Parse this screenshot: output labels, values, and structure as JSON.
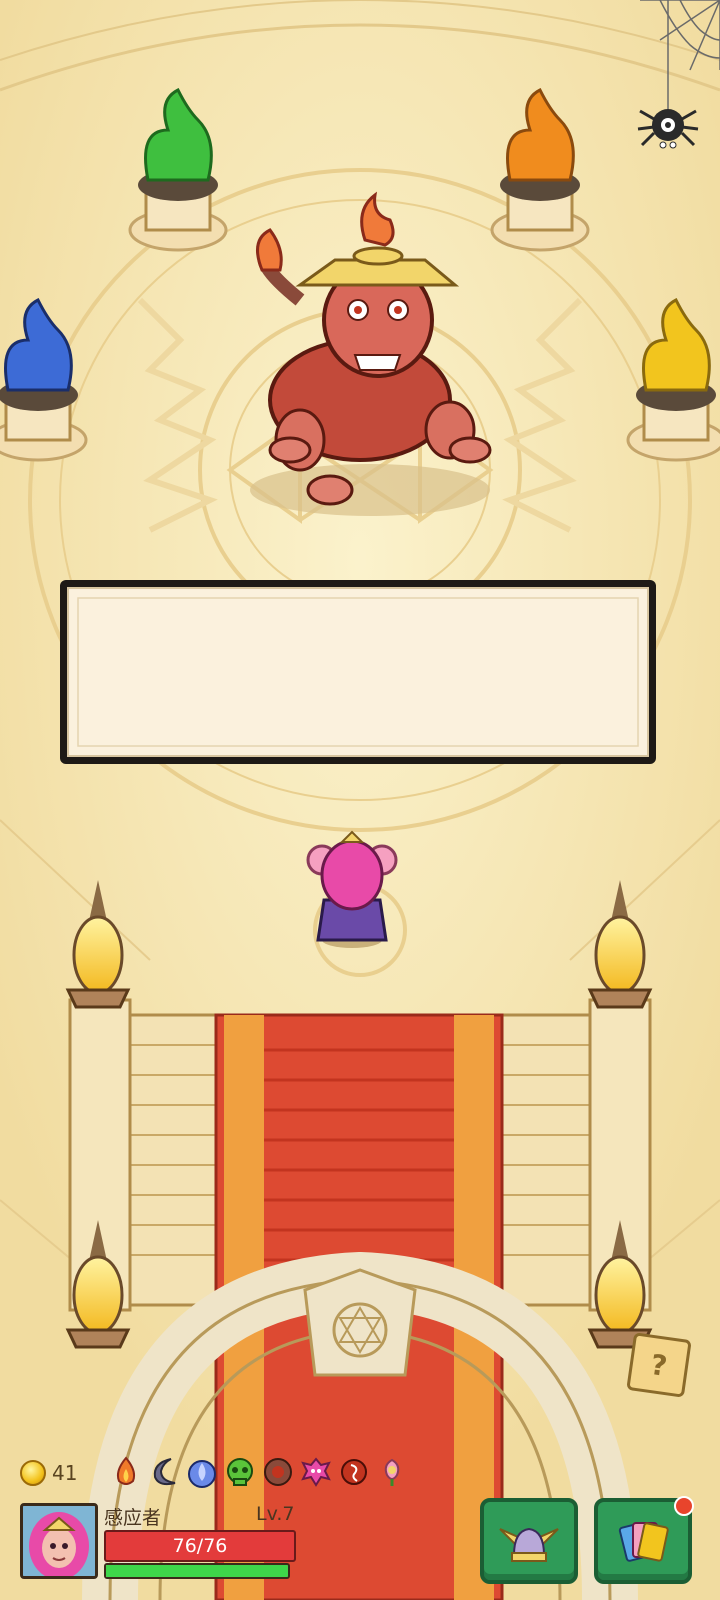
{
  "player": {
    "name": "感应者",
    "level": "Lv.7",
    "hp_text": "76/76",
    "hp_fraction": 1.0,
    "xp_fraction": 1.0
  },
  "currency": {
    "coins": "41"
  },
  "relics": [
    "fire-relic-icon",
    "crescent-relic-icon",
    "blue-flame-relic-icon",
    "skull-relic-icon",
    "shield-relic-icon",
    "pink-demon-relic-icon",
    "red-charm-relic-icon",
    "flower-relic-icon"
  ],
  "colors": {
    "hp": "#e33b3b",
    "xp": "#3ed64a",
    "button": "#2f9b58",
    "carpet": "#dd4a32",
    "flame_green": "#3fbf3f",
    "flame_orange": "#f08c1e",
    "flame_blue": "#3d6bd6",
    "flame_yellow": "#f2c51e"
  },
  "dialog": {
    "text": ""
  },
  "help": {
    "symbol": "?"
  }
}
